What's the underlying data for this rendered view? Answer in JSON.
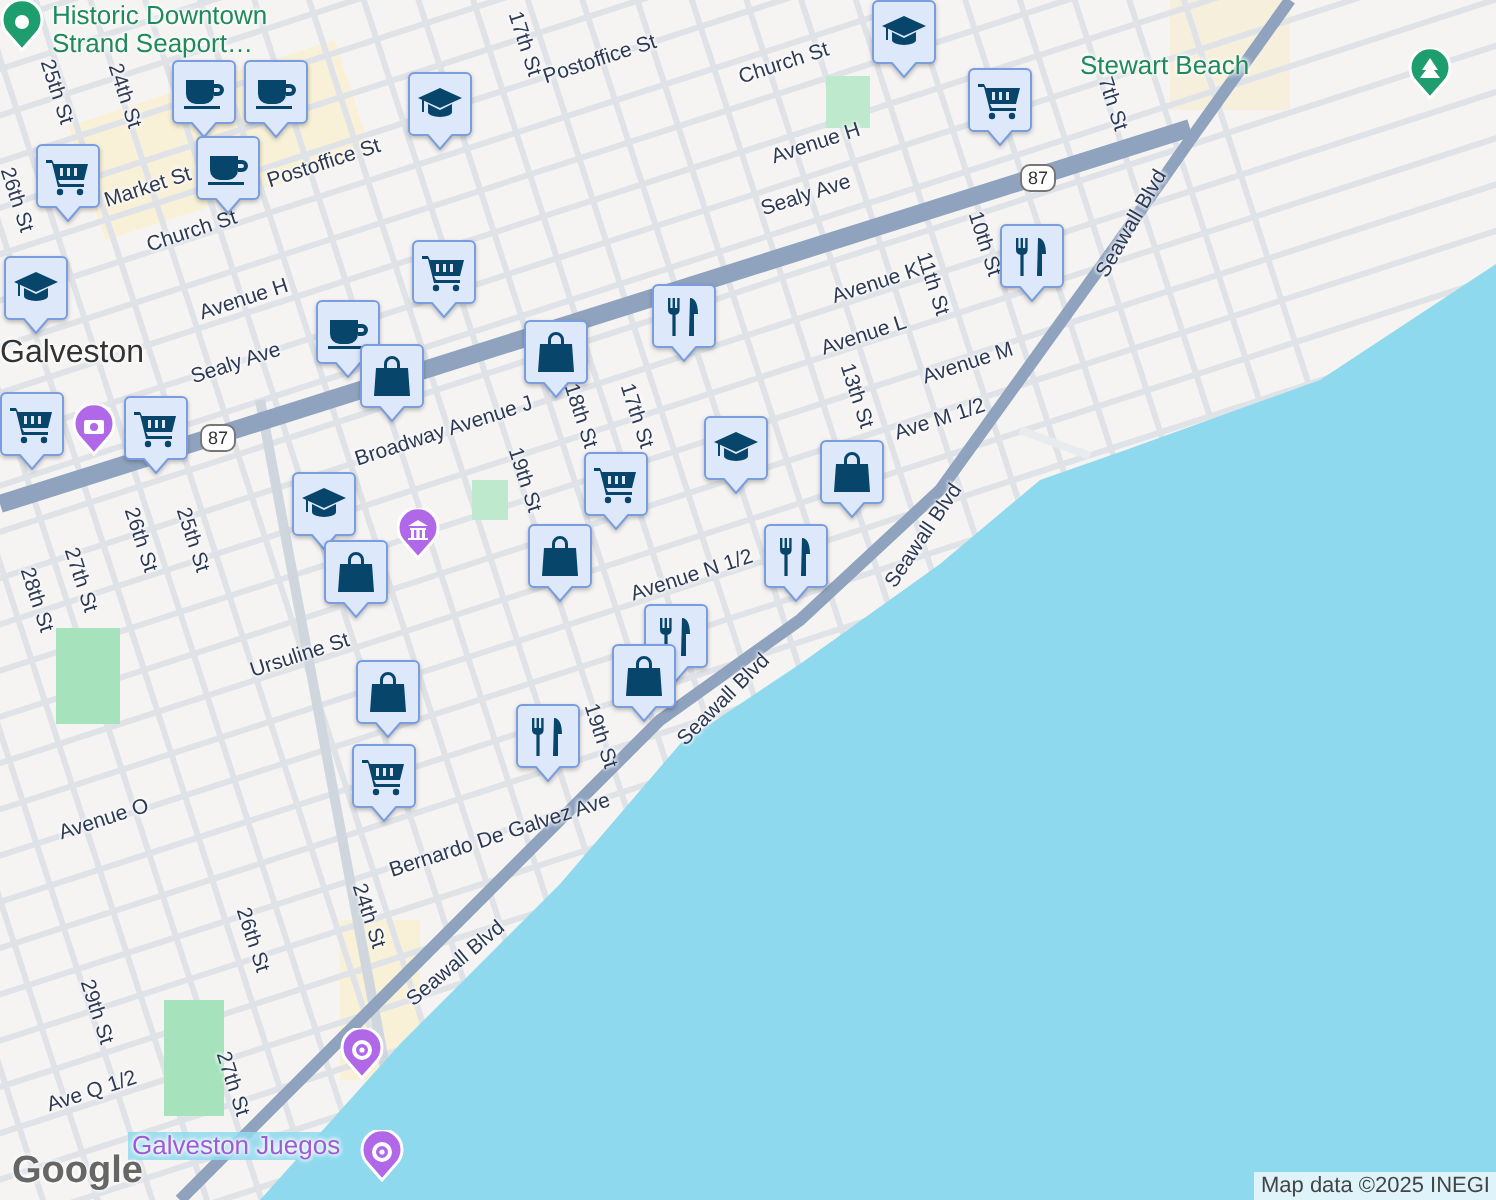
{
  "map": {
    "place_labels": [
      {
        "text": "Historic Downtown Strand Seaport…",
        "kind": "attraction"
      },
      {
        "text": "Stewart Beach",
        "kind": "park"
      },
      {
        "text": "Galveston",
        "kind": "town"
      },
      {
        "text": "Galveston Juegos",
        "kind": "amusement"
      }
    ],
    "street_labels": [
      "25th St",
      "24th St",
      "26th St",
      "Market St",
      "17th St",
      "Postoffice St",
      "Church St",
      "Postoffice St",
      "Church St",
      "Avenue H",
      "Avenue H",
      "Sealy Ave",
      "Sealy Ave",
      "Broadway Avenue J",
      "Avenue K",
      "Avenue L",
      "Avenue M",
      "Ave M 1/2",
      "11th St",
      "10th St",
      "13th St",
      "7th St",
      "Seawall Blvd",
      "Seawall Blvd",
      "Seawall Blvd",
      "Seawall Blvd",
      "19th St",
      "18th St",
      "17th St",
      "27th St",
      "26th St",
      "25th St",
      "28th St",
      "Ursuline St",
      "Avenue O",
      "Bernardo De Galvez Ave",
      "19th St",
      "24th St",
      "26th St",
      "29th St",
      "27th St",
      "Ave Q 1/2",
      "Avenue N 1/2"
    ],
    "route_shields": [
      "87",
      "87"
    ],
    "markers": [
      {
        "kind": "cup"
      },
      {
        "kind": "cup"
      },
      {
        "kind": "cup"
      },
      {
        "kind": "cart"
      },
      {
        "kind": "grad"
      },
      {
        "kind": "grad"
      },
      {
        "kind": "cart"
      },
      {
        "kind": "cart"
      },
      {
        "kind": "cup"
      },
      {
        "kind": "bag"
      },
      {
        "kind": "grad"
      },
      {
        "kind": "cart"
      },
      {
        "kind": "cart"
      },
      {
        "kind": "bag"
      },
      {
        "kind": "fork"
      },
      {
        "kind": "fork"
      },
      {
        "kind": "grad"
      },
      {
        "kind": "cart"
      },
      {
        "kind": "grad"
      },
      {
        "kind": "bag"
      },
      {
        "kind": "bag"
      },
      {
        "kind": "bag"
      },
      {
        "kind": "fork"
      },
      {
        "kind": "fork"
      },
      {
        "kind": "bag"
      },
      {
        "kind": "bag"
      },
      {
        "kind": "fork"
      },
      {
        "kind": "cart"
      }
    ],
    "poi_pins": [
      {
        "kind": "camera"
      },
      {
        "kind": "museum"
      },
      {
        "kind": "ride"
      },
      {
        "kind": "ride"
      },
      {
        "kind": "tree"
      },
      {
        "kind": "landmark"
      }
    ],
    "attribution": "Map data ©2025 INEGI",
    "logo": "Google"
  }
}
